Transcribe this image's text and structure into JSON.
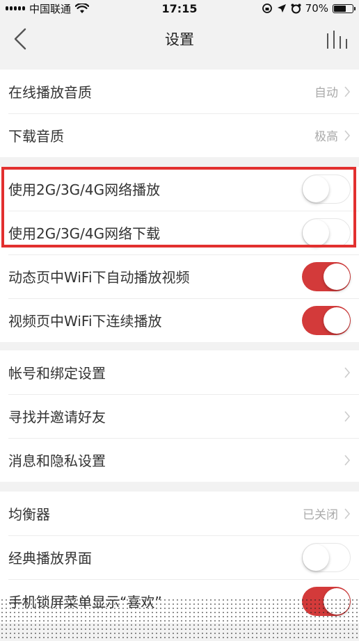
{
  "status_bar": {
    "carrier": "中国联通",
    "time": "17:15",
    "battery_percent": "70%",
    "battery_level": 0.7
  },
  "nav": {
    "title": "设置",
    "back_icon": "chevron-left-icon",
    "right_icon": "equalizer-icon"
  },
  "groups": [
    {
      "rows": [
        {
          "label": "在线播放音质",
          "value": "自动",
          "type": "chevron"
        },
        {
          "label": "下载音质",
          "value": "极高",
          "type": "chevron"
        }
      ]
    },
    {
      "rows": [
        {
          "label": "使用2G/3G/4G网络播放",
          "type": "toggle",
          "on": false
        },
        {
          "label": "使用2G/3G/4G网络下载",
          "type": "toggle",
          "on": false
        },
        {
          "label": "动态页中WiFi下自动播放视频",
          "type": "toggle",
          "on": true
        },
        {
          "label": "视频页中WiFi下连续播放",
          "type": "toggle",
          "on": true
        }
      ]
    },
    {
      "rows": [
        {
          "label": "帐号和绑定设置",
          "type": "chevron"
        },
        {
          "label": "寻找并邀请好友",
          "type": "chevron"
        },
        {
          "label": "消息和隐私设置",
          "type": "chevron"
        }
      ]
    },
    {
      "rows": [
        {
          "label": "均衡器",
          "value": "已关闭",
          "type": "chevron"
        },
        {
          "label": "经典播放界面",
          "type": "toggle",
          "on": false
        },
        {
          "label": "手机锁屏菜单显示“喜欢”",
          "type": "toggle",
          "on": true
        }
      ]
    }
  ],
  "colors": {
    "accent": "#d33a3a",
    "highlight_border": "#e2302f",
    "background": "#f2f2f2"
  }
}
